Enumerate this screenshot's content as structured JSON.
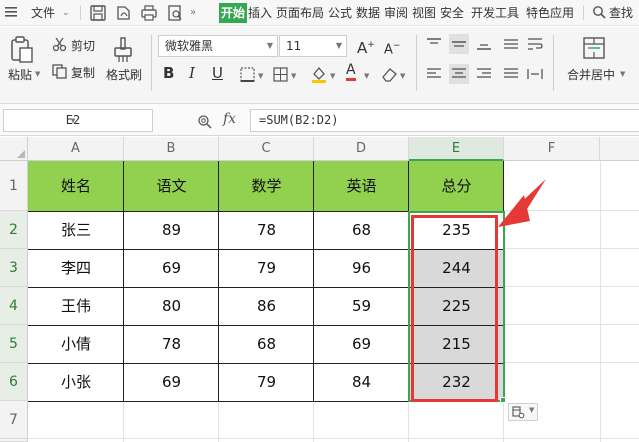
{
  "menubar": {
    "file": "文件",
    "tabs": [
      "开始",
      "插入",
      "页面布局",
      "公式",
      "数据",
      "审阅",
      "视图",
      "安全",
      "开发工具",
      "特色应用"
    ],
    "active_tab": "开始",
    "search": "查找"
  },
  "ribbon": {
    "paste": "粘贴",
    "cut": "剪切",
    "copy": "复制",
    "format_painter": "格式刷",
    "font_name": "微软雅黑",
    "font_size": "11",
    "merge_center": "合并居中"
  },
  "formula_bar": {
    "cell_ref": "E2",
    "fx": "fx",
    "formula": "=SUM(B2:D2)"
  },
  "grid": {
    "columns": [
      "A",
      "B",
      "C",
      "D",
      "E",
      "F"
    ],
    "rows": [
      "1",
      "2",
      "3",
      "4",
      "5",
      "6",
      "7"
    ],
    "selected_column": "E",
    "table": {
      "headers": [
        "姓名",
        "语文",
        "数学",
        "英语",
        "总分"
      ],
      "rows": [
        [
          "张三",
          "89",
          "78",
          "68",
          "235"
        ],
        [
          "李四",
          "69",
          "79",
          "96",
          "244"
        ],
        [
          "王伟",
          "80",
          "86",
          "59",
          "225"
        ],
        [
          "小倩",
          "78",
          "68",
          "69",
          "215"
        ],
        [
          "小张",
          "69",
          "79",
          "84",
          "232"
        ]
      ]
    }
  },
  "colors": {
    "active_tab": "#34a853",
    "header_fill": "#92d050",
    "sum_fill": "#d9d9d9",
    "highlight": "#e53935",
    "selection": "#3aa655"
  }
}
